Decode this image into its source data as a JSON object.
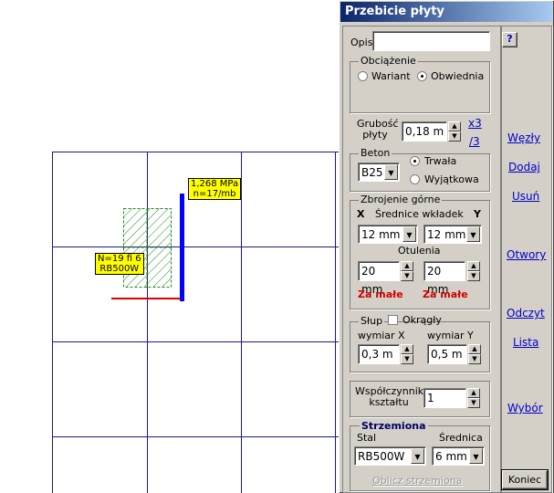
{
  "canvas": {
    "stress_label": "1,268 MPa",
    "count_label": "n=17/mb",
    "reinf_label_1": "N=19 fi 6",
    "reinf_label_2": "RB500W"
  },
  "dialog": {
    "title": "Przebicie płyty",
    "help_label": "?",
    "opis_label": "Opis",
    "opis_value": "",
    "load": {
      "group_label": "Obciążenie",
      "option_variant": "Wariant",
      "option_envelope": "Obwiednia",
      "selected": "Obwiednia"
    },
    "thickness": {
      "label_1": "Grubość",
      "label_2": "płyty",
      "value": "0,18 m",
      "x3": "x3",
      "div3": "/3"
    },
    "concrete": {
      "group_label": "Beton",
      "class_value": "B25",
      "option_permanent": "Trwała",
      "option_exceptional": "Wyjątkowa",
      "selected": "Trwała"
    },
    "top_reinf": {
      "group_label": "Zbrojenie górne",
      "x_label": "X",
      "title": "Średnice wkładek",
      "y_label": "Y",
      "diam_x": "12 mm",
      "diam_y": "12 mm",
      "cover_label": "Otulenia",
      "cover_x": "20 mm",
      "cover_y": "20 mm",
      "warn_x": "Za małe",
      "warn_y": "Za małe"
    },
    "column": {
      "group_label": "Słup",
      "round_label": "Okrągły",
      "dim_x_label": "wymiar X",
      "dim_y_label": "wymiar Y",
      "dim_x": "0,3 m",
      "dim_y": "0,5 m"
    },
    "shape": {
      "label_1": "Współczynnik",
      "label_2": "kształtu",
      "value": "1"
    },
    "stirrups": {
      "group_label": "Strzemiona",
      "steel_label": "Stal",
      "diam_label": "Średnica",
      "steel_value": "RB500W",
      "diam_value": "6 mm",
      "calc_button": "Oblicz strzemiona"
    },
    "side_links": {
      "nodes": "Węzły",
      "add": "Dodaj",
      "remove": "Usuń",
      "openings": "Otwory",
      "read": "Odczyt",
      "list": "Lista",
      "select": "Wybór"
    },
    "close_button": "Koniec"
  }
}
